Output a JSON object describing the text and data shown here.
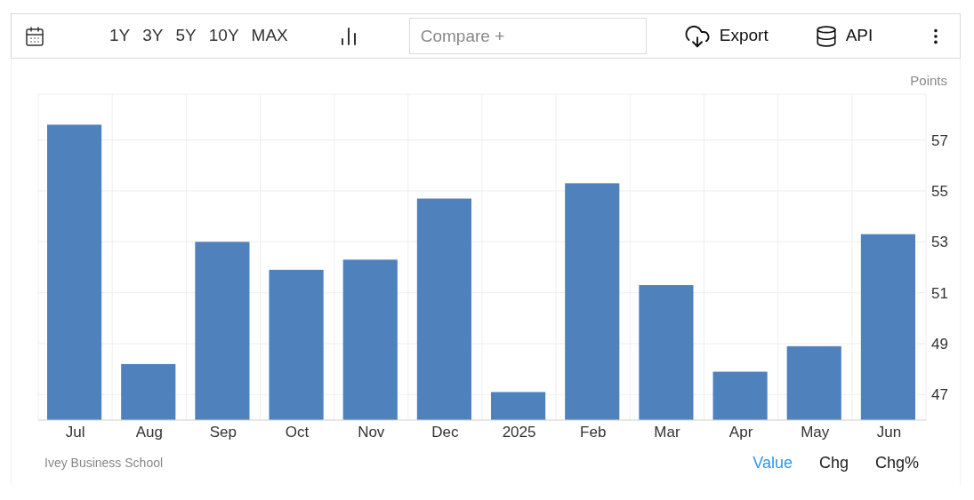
{
  "toolbar": {
    "ranges": [
      "1Y",
      "3Y",
      "5Y",
      "10Y",
      "MAX"
    ],
    "compare": {
      "placeholder": "Compare +"
    },
    "export": "Export",
    "api": "API"
  },
  "chart": {
    "chart_data": {
      "type": "bar",
      "ylabel": "Points",
      "grid": true,
      "categories": [
        "Jul",
        "Aug",
        "Sep",
        "Oct",
        "Nov",
        "Dec",
        "2025",
        "Feb",
        "Mar",
        "Apr",
        "May",
        "Jun"
      ],
      "series": [
        {
          "color": "#4f81bd",
          "values": [
            57.6,
            48.2,
            53.0,
            51.9,
            52.3,
            54.7,
            47.1,
            55.3,
            51.3,
            47.9,
            48.9,
            53.3
          ]
        }
      ],
      "ylim": [
        46,
        58.8
      ],
      "yticks": [
        47,
        49,
        51,
        53,
        55,
        57
      ]
    }
  },
  "footer": {
    "source": "Ivey Business School",
    "views": [
      {
        "label": "Value",
        "selected": true
      },
      {
        "label": "Chg",
        "selected": false
      },
      {
        "label": "Chg%",
        "selected": false
      }
    ]
  }
}
